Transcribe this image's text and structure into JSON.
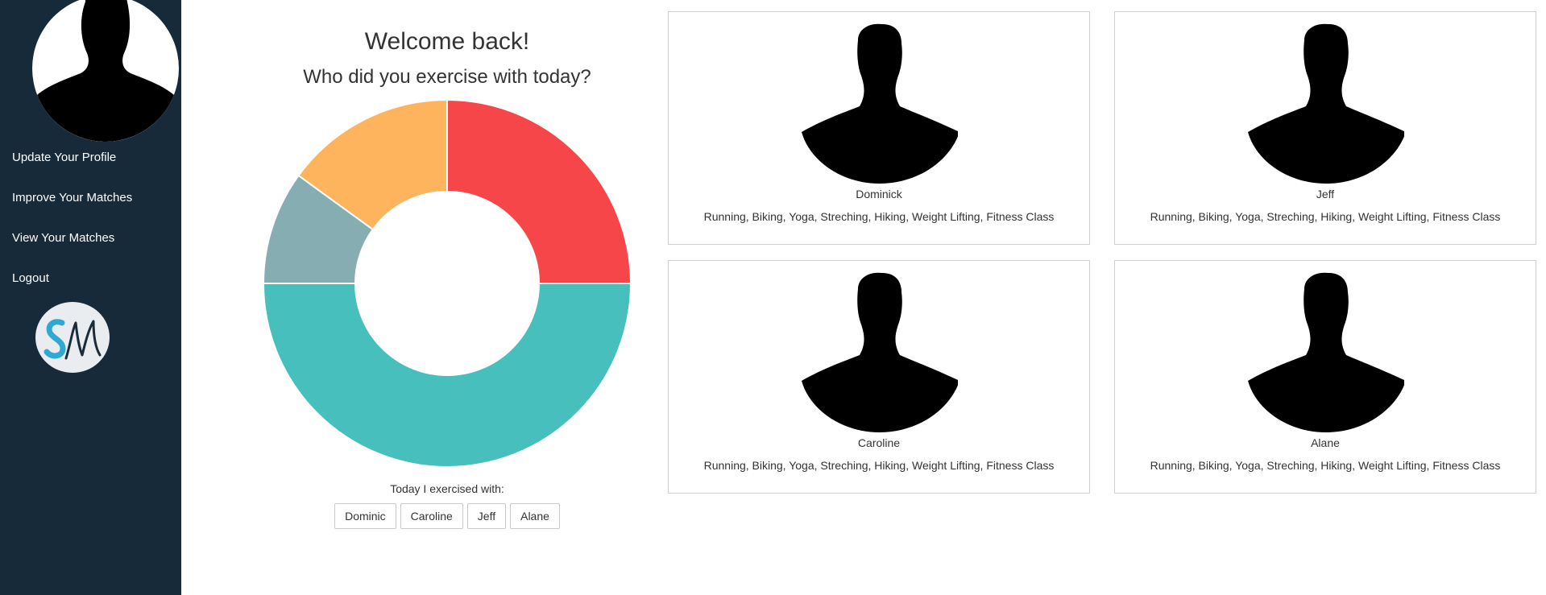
{
  "sidebar": {
    "nav": [
      {
        "label": "Update Your Profile"
      },
      {
        "label": "Improve Your Matches"
      },
      {
        "label": "View Your Matches"
      },
      {
        "label": "Logout"
      }
    ],
    "avatar_icon": "user-silhouette-icon",
    "logo_icon": "sm-logo-icon"
  },
  "main": {
    "title": "Welcome back!",
    "subtitle": "Who did you exercise with today?",
    "exercised_label": "Today I exercised with:",
    "partner_buttons": [
      "Dominic",
      "Caroline",
      "Jeff",
      "Alane"
    ]
  },
  "chart_data": {
    "type": "pie",
    "style": "doughnut",
    "slices": [
      {
        "value": 25,
        "color": "#f7464a"
      },
      {
        "value": 50,
        "color": "#46bfbd"
      },
      {
        "value": 10,
        "color": "#85adb2"
      },
      {
        "value": 15,
        "color": "#fdb45c"
      }
    ]
  },
  "matches": [
    {
      "name": "Dominick",
      "activities": "Running, Biking, Yoga, Streching, Hiking, Weight Lifting, Fitness Class"
    },
    {
      "name": "Jeff",
      "activities": "Running, Biking, Yoga, Streching, Hiking, Weight Lifting, Fitness Class"
    },
    {
      "name": "Caroline",
      "activities": "Running, Biking, Yoga, Streching, Hiking, Weight Lifting, Fitness Class"
    },
    {
      "name": "Alane",
      "activities": "Running, Biking, Yoga, Streching, Hiking, Weight Lifting, Fitness Class"
    }
  ],
  "colors": {
    "sidebar_bg": "#172a3a",
    "accent": "#2fa9d3"
  }
}
